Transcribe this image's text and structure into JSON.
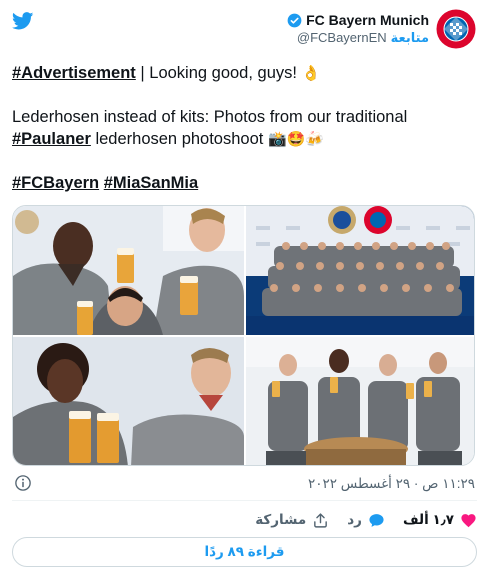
{
  "header": {
    "account_name": "FC Bayern Munich",
    "handle": "@FCBayernEN",
    "follow_label": "متابعة"
  },
  "tweet": {
    "line1_hashtag": "#Advertisement",
    "line1_rest": " | Looking good, guys! ",
    "line1_emoji": "👌",
    "line2_text": "Lederhosen instead of kits: Photos from our traditional",
    "line3_hashtag": "#Paulaner",
    "line3_rest": " lederhosen photoshoot ",
    "line3_emojis": "📸🤩🍻",
    "hashtag_fcbayern": "#FCBayern",
    "hashtag_miasanmia": "#MiaSanMia"
  },
  "meta": {
    "timestamp": "١١:٢٩ ص · ٢٩ أغسطس ٢٠٢٢"
  },
  "actions": {
    "like_count": "١٫٧ ألف",
    "reply_label": "رد",
    "share_label": "مشاركة"
  },
  "read_replies_label": "قراءة ٨٩ ردًا",
  "colors": {
    "twitter_blue": "#1d9bf0",
    "like_pink": "#f91880",
    "bayern_red": "#dc052d",
    "text_gray": "#536471"
  }
}
